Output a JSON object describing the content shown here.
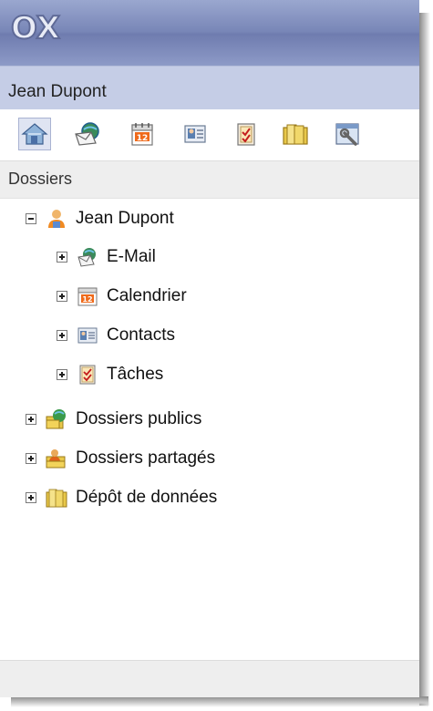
{
  "app": {
    "logo_text": "OX"
  },
  "user": {
    "name": "Jean Dupont"
  },
  "toolbar": {
    "buttons": [
      {
        "icon": "home-icon",
        "label": "Accueil"
      },
      {
        "icon": "mail-icon",
        "label": "E-Mail"
      },
      {
        "icon": "calendar-icon",
        "label": "Calendrier"
      },
      {
        "icon": "contacts-icon",
        "label": "Contacts"
      },
      {
        "icon": "tasks-icon",
        "label": "Tâches"
      },
      {
        "icon": "infostore-icon",
        "label": "Dépôt de données"
      },
      {
        "icon": "settings-icon",
        "label": "Paramètres"
      }
    ]
  },
  "sidebar": {
    "section_title": "Dossiers",
    "tree": {
      "root": {
        "label": "Jean Dupont",
        "expanded": true,
        "icon": "user-icon"
      },
      "children": [
        {
          "label": "E-Mail",
          "icon": "mail-icon"
        },
        {
          "label": "Calendrier",
          "icon": "calendar-icon",
          "calendar_day": "12"
        },
        {
          "label": "Contacts",
          "icon": "contacts-icon"
        },
        {
          "label": "Tâches",
          "icon": "tasks-icon"
        }
      ],
      "top_level": [
        {
          "label": "Dossiers publics",
          "icon": "public-folders-icon"
        },
        {
          "label": "Dossiers partagés",
          "icon": "shared-folders-icon"
        },
        {
          "label": "Dépôt de données",
          "icon": "infostore-icon"
        }
      ]
    }
  },
  "colors": {
    "top_bar": "#7886b7",
    "user_bar": "#c5cde6",
    "section_bg": "#eeeeee"
  }
}
